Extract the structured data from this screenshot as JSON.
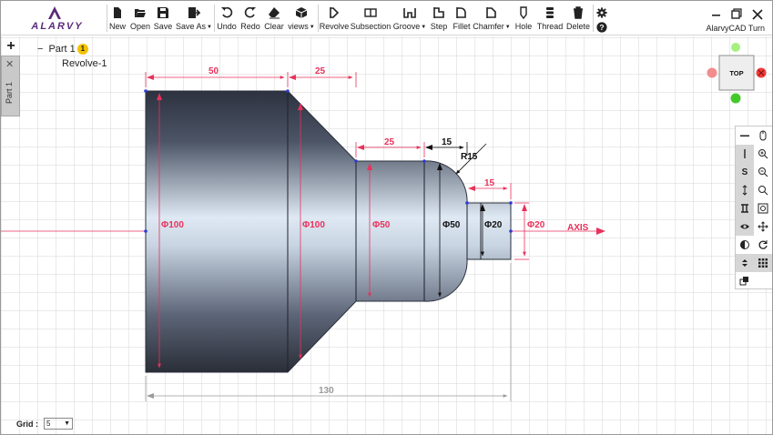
{
  "app": {
    "title": "AlarvyCAD Turn",
    "logo_text": "ALARVY"
  },
  "toolbar": {
    "buttons": [
      {
        "id": "new",
        "label": "New",
        "icon": "new-file-icon"
      },
      {
        "id": "open",
        "label": "Open",
        "icon": "folder-open-icon"
      },
      {
        "id": "save",
        "label": "Save",
        "icon": "save-icon"
      },
      {
        "id": "saveas",
        "label": "Save As",
        "icon": "save-as-icon",
        "dropdown": true
      },
      {
        "id": "undo",
        "label": "Undo",
        "icon": "undo-icon"
      },
      {
        "id": "redo",
        "label": "Redo",
        "icon": "redo-icon"
      },
      {
        "id": "clear",
        "label": "Clear",
        "icon": "eraser-icon"
      },
      {
        "id": "views",
        "label": "views",
        "icon": "cube-icon",
        "dropdown": true
      },
      {
        "id": "revolve",
        "label": "Revolve",
        "icon": "revolve-icon"
      },
      {
        "id": "subsection",
        "label": "Subsection",
        "icon": "subsection-icon"
      },
      {
        "id": "groove",
        "label": "Groove",
        "icon": "groove-icon",
        "dropdown": true
      },
      {
        "id": "step",
        "label": "Step",
        "icon": "step-icon"
      },
      {
        "id": "fillet",
        "label": "Fillet",
        "icon": "fillet-icon"
      },
      {
        "id": "chamfer",
        "label": "Chamfer",
        "icon": "chamfer-icon",
        "dropdown": true
      },
      {
        "id": "hole",
        "label": "Hole",
        "icon": "hole-icon"
      },
      {
        "id": "thread",
        "label": "Thread",
        "icon": "thread-icon"
      },
      {
        "id": "delete",
        "label": "Delete",
        "icon": "trash-icon"
      }
    ],
    "settings_icon": "gear-icon",
    "help_icon": "help-icon"
  },
  "window_controls": [
    "minimize-icon",
    "restore-icon",
    "close-icon"
  ],
  "side_tab": {
    "add_icon": "plus-icon",
    "close_icon": "close-icon",
    "label": "Part 1"
  },
  "tree": {
    "root_label": "Part 1",
    "collapse_symbol": "−",
    "badge": "1",
    "child_label": "Revolve-1"
  },
  "nav_cube": {
    "face_label": "TOP",
    "colors": {
      "top": "#a6f080",
      "bottom": "#43c92a",
      "left": "#f28d8d",
      "right": "#ef3b3b"
    }
  },
  "grid": {
    "label": "Grid :",
    "value": "5"
  },
  "drawing": {
    "dimensions": {
      "len_section_1": "50",
      "len_cone": "25",
      "len_section_3": "25",
      "len_fillet_offset": "15",
      "radius": "R15",
      "len_pin": "15",
      "total_length": "130",
      "dia_1": "Φ100",
      "dia_2": "Φ100",
      "dia_3": "Φ50",
      "dia_4": "Φ50",
      "dia_5": "Φ20",
      "dia_6": "Φ20"
    },
    "axis_label": "AXIS",
    "colors": {
      "dimension": "#e8315b",
      "dimension_black": "#111111",
      "overall_dim": "#9a9a9a",
      "grid": "#d3d3d3",
      "axis": "#e8315b",
      "part_edge": "#2a2f3a"
    }
  },
  "side_tools": [
    {
      "icon": "minus-icon"
    },
    {
      "icon": "mouse-icon"
    },
    {
      "icon": "pipe-icon"
    },
    {
      "icon": "zoom-in-icon"
    },
    {
      "icon": "s-icon"
    },
    {
      "icon": "zoom-out-icon"
    },
    {
      "icon": "vertical-arrow-icon"
    },
    {
      "icon": "zoom-window-icon"
    },
    {
      "icon": "i-beam-icon"
    },
    {
      "icon": "zoom-fit-icon"
    },
    {
      "icon": "eye-icon"
    },
    {
      "icon": "move-icon"
    },
    {
      "icon": "contrast-icon"
    },
    {
      "icon": "rotate-icon"
    },
    {
      "icon": "updown-icon"
    },
    {
      "icon": "grid-icon"
    },
    {
      "icon": "copy-icon"
    }
  ]
}
